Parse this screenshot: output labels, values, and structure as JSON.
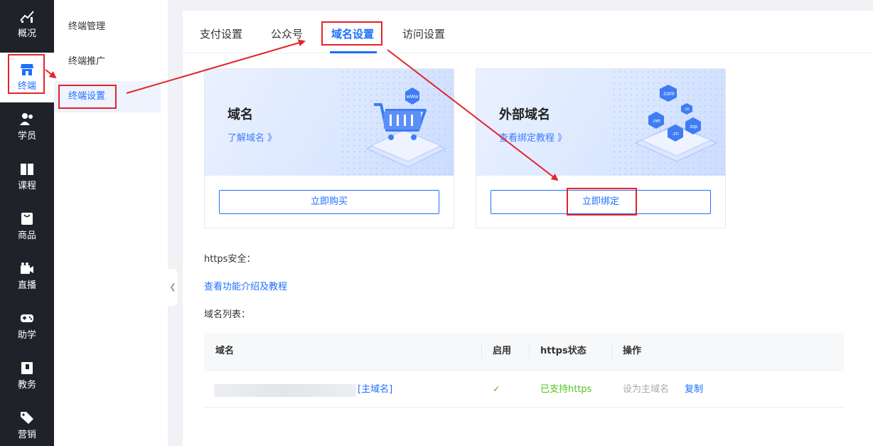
{
  "nav": {
    "items": [
      {
        "label": "概况",
        "icon": "chart-icon"
      },
      {
        "label": "终端",
        "icon": "store-icon"
      },
      {
        "label": "学员",
        "icon": "users-icon"
      },
      {
        "label": "课程",
        "icon": "book-icon"
      },
      {
        "label": "商品",
        "icon": "bag-icon"
      },
      {
        "label": "直播",
        "icon": "video-icon"
      },
      {
        "label": "助学",
        "icon": "gamepad-icon"
      },
      {
        "label": "教务",
        "icon": "notebook-icon"
      },
      {
        "label": "营销",
        "icon": "tag-icon"
      }
    ]
  },
  "subnav": {
    "items": [
      {
        "label": "终端管理"
      },
      {
        "label": "终端推广"
      },
      {
        "label": "终端设置"
      }
    ]
  },
  "tabs": [
    {
      "label": "支付设置"
    },
    {
      "label": "公众号"
    },
    {
      "label": "域名设置"
    },
    {
      "label": "访问设置"
    }
  ],
  "cards": [
    {
      "title": "域名",
      "link": "了解域名 》",
      "button": "立即购买",
      "illustration": "cart-icon",
      "badge": "wWw"
    },
    {
      "title": "外部域名",
      "link": "查看绑定教程 》",
      "button": "立即绑定",
      "illustration": "domains-icon",
      "badges": [
        ".com",
        ".cc",
        ".net",
        ".top",
        ".cn"
      ]
    }
  ],
  "https_label": "https安全：",
  "https_link": "查看功能介绍及教程",
  "domain_list_label": "域名列表：",
  "table": {
    "headers": [
      "域名",
      "启用",
      "https状态",
      "操作"
    ],
    "rows": [
      {
        "domain_tag": "[主域名]",
        "enabled": "✓",
        "https_status": "已支持https",
        "action_primary": "设为主域名",
        "action_copy": "复制"
      }
    ]
  },
  "colors": {
    "accent": "#1e6fff",
    "nav_bg": "#1f2329",
    "success": "#52c41a",
    "annotation": "#e3242b"
  }
}
